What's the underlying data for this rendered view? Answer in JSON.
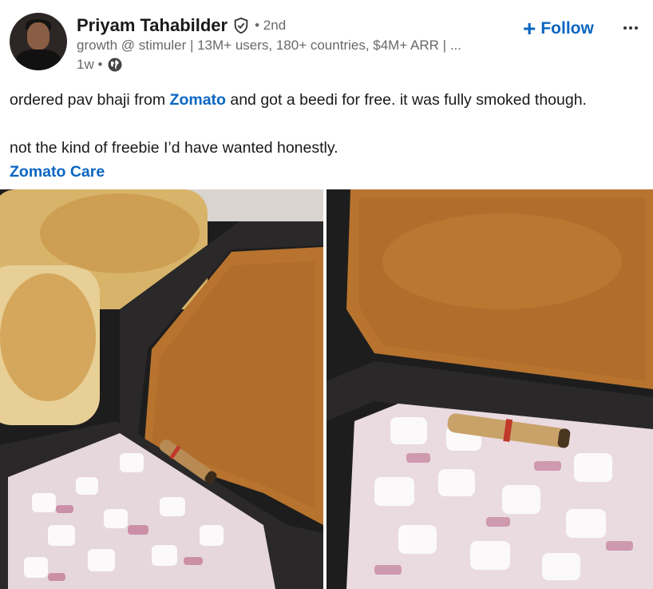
{
  "author": {
    "name": "Priyam Tahabilder",
    "degree": "• 2nd",
    "headline": "growth @ stimuler | 13M+ users, 180+ countries, $4M+ ARR | ...",
    "time": "1w •"
  },
  "actions": {
    "follow_plus": "+",
    "follow_label": "Follow"
  },
  "post": {
    "line1_before": "ordered pav bhaji from ",
    "line1_mention": "Zomato",
    "line1_after": " and got a beedi for free. it was fully smoked though.",
    "line2": "not the kind of freebie I’d have wanted honestly.",
    "mention_line": "Zomato Care"
  },
  "icons": {
    "verified": "verified-shield-icon",
    "visibility": "globe-icon",
    "more": "more-dots-icon"
  },
  "colors": {
    "link": "#0a66c2",
    "text_primary": "#191919",
    "text_secondary": "#666666"
  }
}
